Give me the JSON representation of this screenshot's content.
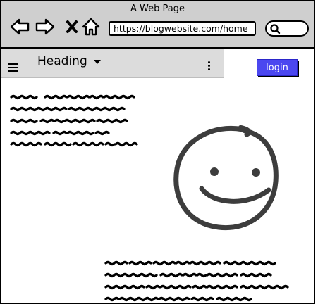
{
  "browser": {
    "title": "A Web Page",
    "url": "https://blogwebsite.com/home",
    "icons": [
      "back-arrow-icon",
      "forward-arrow-icon",
      "close-x-icon",
      "home-icon",
      "search-icon"
    ]
  },
  "app_bar": {
    "heading": "Heading",
    "menu_icon": "hamburger-menu-icon",
    "dropdown_icon": "caret-down-icon",
    "more_icon": "kebab-menu-icon"
  },
  "login_button": {
    "label": "login",
    "color": "#4b47f0"
  },
  "content": {
    "image": "smiley-face-icon"
  }
}
